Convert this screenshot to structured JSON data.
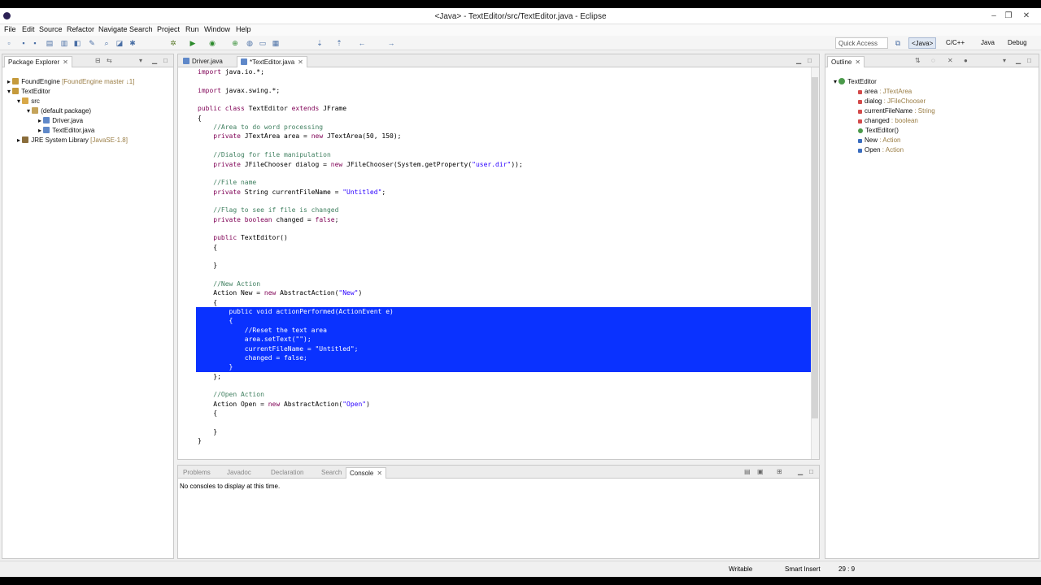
{
  "window": {
    "title": "<Java> - TextEditor/src/TextEditor.java - Eclipse"
  },
  "menu": [
    "File",
    "Edit",
    "Source",
    "Refactor",
    "Navigate",
    "Search",
    "Project",
    "Run",
    "Window",
    "Help"
  ],
  "toolbar": {
    "quick_access": "Quick Access",
    "perspectives": [
      "<Java>",
      "C/C++",
      "Java",
      "Debug"
    ]
  },
  "package_explorer": {
    "tab": "Package Explorer",
    "items": [
      {
        "label": "FoundEngine",
        "decoration": " [FoundEngine master ↓1]",
        "icon": "project-icon"
      },
      {
        "label": "TextEditor",
        "decoration": "",
        "icon": "project-icon"
      },
      {
        "label": "src",
        "decoration": "",
        "icon": "folder-icon"
      },
      {
        "label": "(default package)",
        "decoration": "",
        "icon": "package-icon"
      },
      {
        "label": "Driver.java",
        "decoration": "",
        "icon": "java-file-icon"
      },
      {
        "label": "TextEditor.java",
        "decoration": "",
        "icon": "java-file-icon"
      },
      {
        "label": "JRE System Library",
        "decoration": " [JavaSE-1.8]",
        "icon": "library-icon"
      }
    ]
  },
  "editor": {
    "tabs": [
      "Driver.java",
      "*TextEditor.java"
    ],
    "lines": [
      [
        [
          "kw",
          "import "
        ],
        [
          "t",
          "java.io.*;"
        ]
      ],
      [],
      [
        [
          "kw",
          "import "
        ],
        [
          "t",
          "javax.swing.*;"
        ]
      ],
      [],
      [
        [
          "kw",
          "public class "
        ],
        [
          "t",
          "TextEditor "
        ],
        [
          "kw",
          "extends "
        ],
        [
          "t",
          "JFrame"
        ]
      ],
      [
        [
          "t",
          "{"
        ]
      ],
      [
        [
          "cmt",
          "    //Area to do word processing"
        ]
      ],
      [
        [
          "kw",
          "    private "
        ],
        [
          "t",
          "JTextArea area = "
        ],
        [
          "kw",
          "new "
        ],
        [
          "t",
          "JTextArea(50, 150);"
        ]
      ],
      [],
      [
        [
          "cmt",
          "    //Dialog for file manipulation"
        ]
      ],
      [
        [
          "kw",
          "    private "
        ],
        [
          "t",
          "JFileChooser dialog = "
        ],
        [
          "kw",
          "new "
        ],
        [
          "t",
          "JFileChooser(System.getProperty("
        ],
        [
          "str",
          "\"user.dir\""
        ],
        [
          "t",
          "));"
        ]
      ],
      [],
      [
        [
          "cmt",
          "    //File name"
        ]
      ],
      [
        [
          "kw",
          "    private "
        ],
        [
          "t",
          "String currentFileName = "
        ],
        [
          "str",
          "\"Untitled\""
        ],
        [
          "t",
          ";"
        ]
      ],
      [],
      [
        [
          "cmt",
          "    //Flag to see if file is changed"
        ]
      ],
      [
        [
          "kw",
          "    private boolean "
        ],
        [
          "t",
          "changed = "
        ],
        [
          "kw",
          "false"
        ],
        [
          "t",
          ";"
        ]
      ],
      [],
      [
        [
          "kw",
          "    public "
        ],
        [
          "t",
          "TextEditor()"
        ]
      ],
      [
        [
          "t",
          "    {"
        ]
      ],
      [],
      [
        [
          "t",
          "    }"
        ]
      ],
      [],
      [
        [
          "cmt",
          "    //New Action"
        ]
      ],
      [
        [
          "t",
          "    Action New = "
        ],
        [
          "kw",
          "new "
        ],
        [
          "t",
          "AbstractAction("
        ],
        [
          "str",
          "\"New\""
        ],
        [
          "t",
          ")"
        ]
      ],
      [
        [
          "t",
          "    {"
        ]
      ],
      [
        [
          "t",
          "        public void actionPerformed(ActionEvent e)"
        ]
      ],
      [
        [
          "t",
          "        {"
        ]
      ],
      [
        [
          "t",
          "            //Reset the text area"
        ]
      ],
      [
        [
          "t",
          "            area.setText(\"\");"
        ]
      ],
      [
        [
          "t",
          "            currentFileName = \"Untitled\";"
        ]
      ],
      [
        [
          "t",
          "            changed = false;"
        ]
      ],
      [
        [
          "t",
          "        }"
        ]
      ],
      [
        [
          "t",
          "    };"
        ]
      ],
      [],
      [
        [
          "cmt",
          "    //Open Action"
        ]
      ],
      [
        [
          "t",
          "    Action Open = "
        ],
        [
          "kw",
          "new "
        ],
        [
          "t",
          "AbstractAction("
        ],
        [
          "str",
          "\"Open\""
        ],
        [
          "t",
          ")"
        ]
      ],
      [
        [
          "t",
          "    {"
        ]
      ],
      [],
      [
        [
          "t",
          "    }"
        ]
      ],
      [
        [
          "t",
          "}"
        ]
      ]
    ]
  },
  "outline": {
    "tab": "Outline",
    "root": "TextEditor",
    "items": [
      {
        "name": "area",
        "type": " : JTextArea"
      },
      {
        "name": "dialog",
        "type": " : JFileChooser"
      },
      {
        "name": "currentFileName",
        "type": " : String"
      },
      {
        "name": "changed",
        "type": " : boolean"
      },
      {
        "name": "TextEditor()",
        "type": ""
      },
      {
        "name": "New",
        "type": " : Action"
      },
      {
        "name": "Open",
        "type": " : Action"
      }
    ]
  },
  "bottom": {
    "tabs": [
      "Problems",
      "Javadoc",
      "Declaration",
      "Search",
      "Console"
    ],
    "message": "No consoles to display at this time."
  },
  "status": {
    "writable": "Writable",
    "insert_mode": "Smart Insert",
    "position": "29 : 9"
  },
  "colors": {
    "selection": "#0a32ff",
    "keyword": "#7f0055",
    "string": "#2a00ff",
    "comment": "#3f7f5f"
  }
}
